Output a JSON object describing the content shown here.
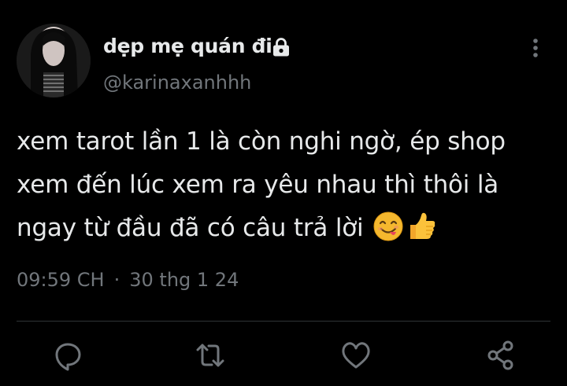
{
  "user": {
    "display_name": "dẹp mẹ quán đi",
    "handle": "@karinaxanhhh",
    "avatar_icon": "avatar-photo",
    "verified_icon": "lock-icon"
  },
  "tweet": {
    "lines": [
      "xem tarot lần 1 là còn nghi ngờ, ép shop",
      "xem đến lúc xem ra yêu nhau thì thôi là",
      "ngay từ đầu đã có câu trả lời"
    ],
    "emojis": [
      "savoring-face-emoji",
      "thumbs-up-emoji"
    ]
  },
  "meta": {
    "time": "09:59 CH",
    "separator": "·",
    "date": "30 thg 1 24"
  },
  "actions": {
    "reply_icon": "reply-icon",
    "retweet_icon": "retweet-icon",
    "like_icon": "heart-icon",
    "share_icon": "share-icon"
  },
  "colors": {
    "background": "#000000",
    "text": "#e7e9ea",
    "secondary": "#71767b",
    "divider": "#2f3336"
  }
}
